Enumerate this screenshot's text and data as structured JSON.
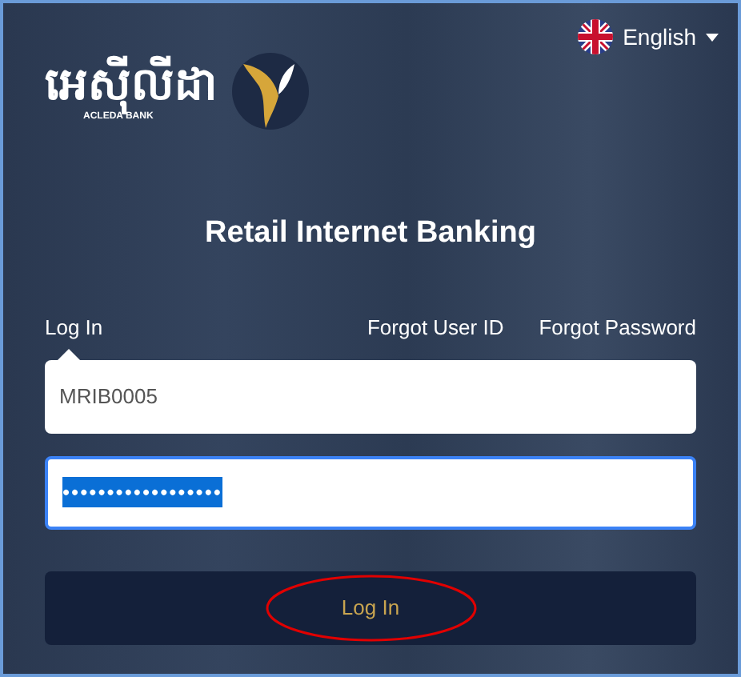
{
  "language": {
    "label": "English"
  },
  "logo": {
    "khmer": "អេស៊ីលីដា",
    "name": "ACLEDA BANK"
  },
  "title": "Retail Internet Banking",
  "tabs": [
    {
      "label": "Log In",
      "selected": true
    },
    {
      "label": "Forgot User ID",
      "selected": false
    },
    {
      "label": "Forgot Password",
      "selected": false
    }
  ],
  "username": {
    "value": "MRIB0005"
  },
  "password": {
    "value": "••••••••••••••••••",
    "highlighted": true,
    "focused": true
  },
  "login_button": {
    "label": "Log In",
    "annotation": {
      "kind": "ellipse",
      "color": "#e00000"
    }
  }
}
